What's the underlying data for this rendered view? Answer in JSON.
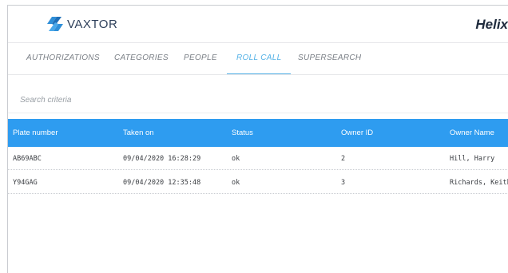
{
  "header": {
    "logo_text": "VAXTOR",
    "product_title": "Helix"
  },
  "tabs": [
    {
      "label": "AUTHORIZATIONS",
      "active": false
    },
    {
      "label": "CATEGORIES",
      "active": false
    },
    {
      "label": "PEOPLE",
      "active": false
    },
    {
      "label": "ROLL CALL",
      "active": true
    },
    {
      "label": "SUPERSEARCH",
      "active": false
    }
  ],
  "search": {
    "placeholder": "Search criteria",
    "value": ""
  },
  "table": {
    "columns": [
      "Plate number",
      "Taken on",
      "Status",
      "Owner ID",
      "Owner Name"
    ],
    "rows": [
      [
        "AB69ABC",
        "09/04/2020 16:28:29",
        "ok",
        "2",
        "Hill, Harry"
      ],
      [
        "Y94GAG",
        "09/04/2020 12:35:48",
        "ok",
        "3",
        "Richards, Keith"
      ]
    ]
  },
  "colors": {
    "accent": "#55b2e6",
    "table_header": "#2e9cf0",
    "logo_blue": "#2f8fd8",
    "logo_dark": "#2d3f5a"
  }
}
